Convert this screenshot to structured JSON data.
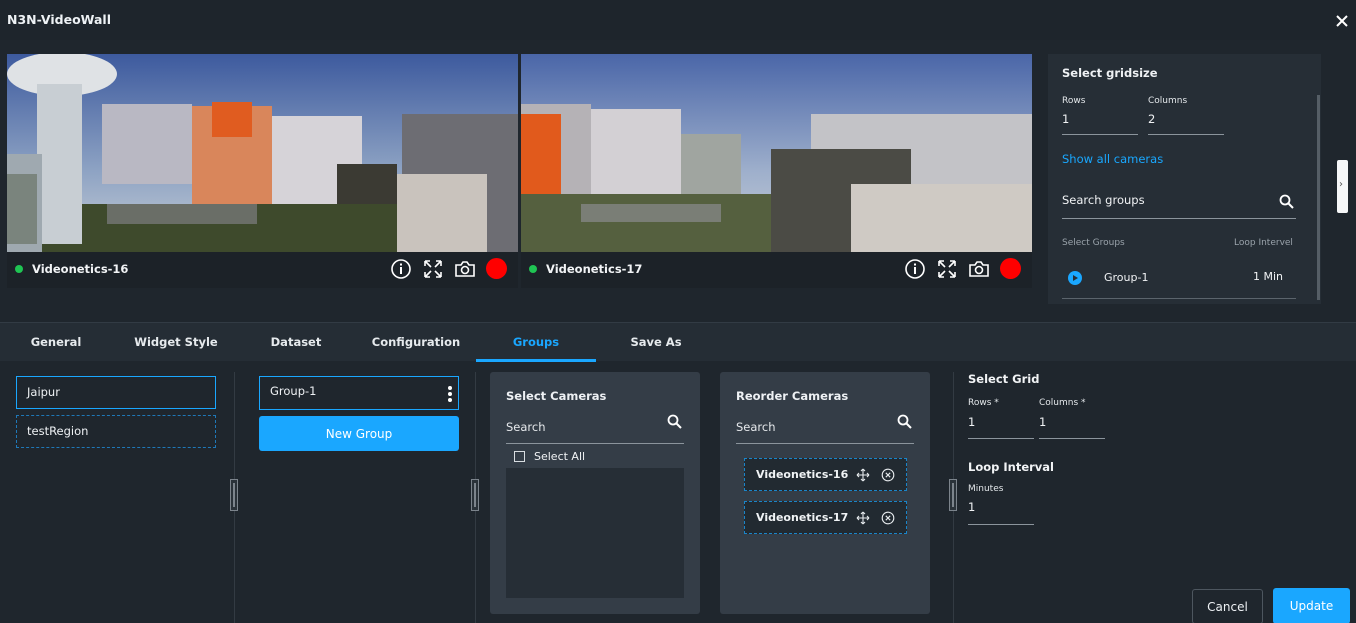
{
  "window": {
    "title": "N3N-VideoWall",
    "close_icon": "close-icon"
  },
  "colors": {
    "accent": "#1aa7ff",
    "status_online": "#1fc453",
    "record": "#ff0000"
  },
  "videos": [
    {
      "camera": "Videonetics-16"
    },
    {
      "camera": "Videonetics-17"
    }
  ],
  "grid_panel": {
    "title": "Select gridsize",
    "rows_label": "Rows",
    "rows_value": "1",
    "columns_label": "Columns",
    "columns_value": "2",
    "show_all_link": "Show all cameras",
    "search_label": "Search groups",
    "col_groups": "Select Groups",
    "col_interval": "Loop Intervel",
    "group": {
      "name": "Group-1",
      "interval": "1 Min"
    }
  },
  "tabs": [
    "General",
    "Widget Style",
    "Dataset",
    "Configuration",
    "Groups",
    "Save As"
  ],
  "active_tab": "Groups",
  "regions": [
    "Jaipur",
    "testRegion"
  ],
  "groups": {
    "selected": "Group-1",
    "new_button": "New Group"
  },
  "select_cameras": {
    "title": "Select Cameras",
    "search_placeholder": "Search",
    "select_all": "Select All"
  },
  "reorder_cameras": {
    "title": "Reorder Cameras",
    "search_placeholder": "Search",
    "items": [
      "Videonetics-16",
      "Videonetics-17"
    ]
  },
  "settings": {
    "grid_title": "Select Grid",
    "rows_label": "Rows *",
    "rows_value": "1",
    "columns_label": "Columns *",
    "columns_value": "1",
    "loop_title": "Loop Interval",
    "minutes_label": "Minutes",
    "minutes_value": "1"
  },
  "actions": {
    "cancel": "Cancel",
    "update": "Update"
  }
}
